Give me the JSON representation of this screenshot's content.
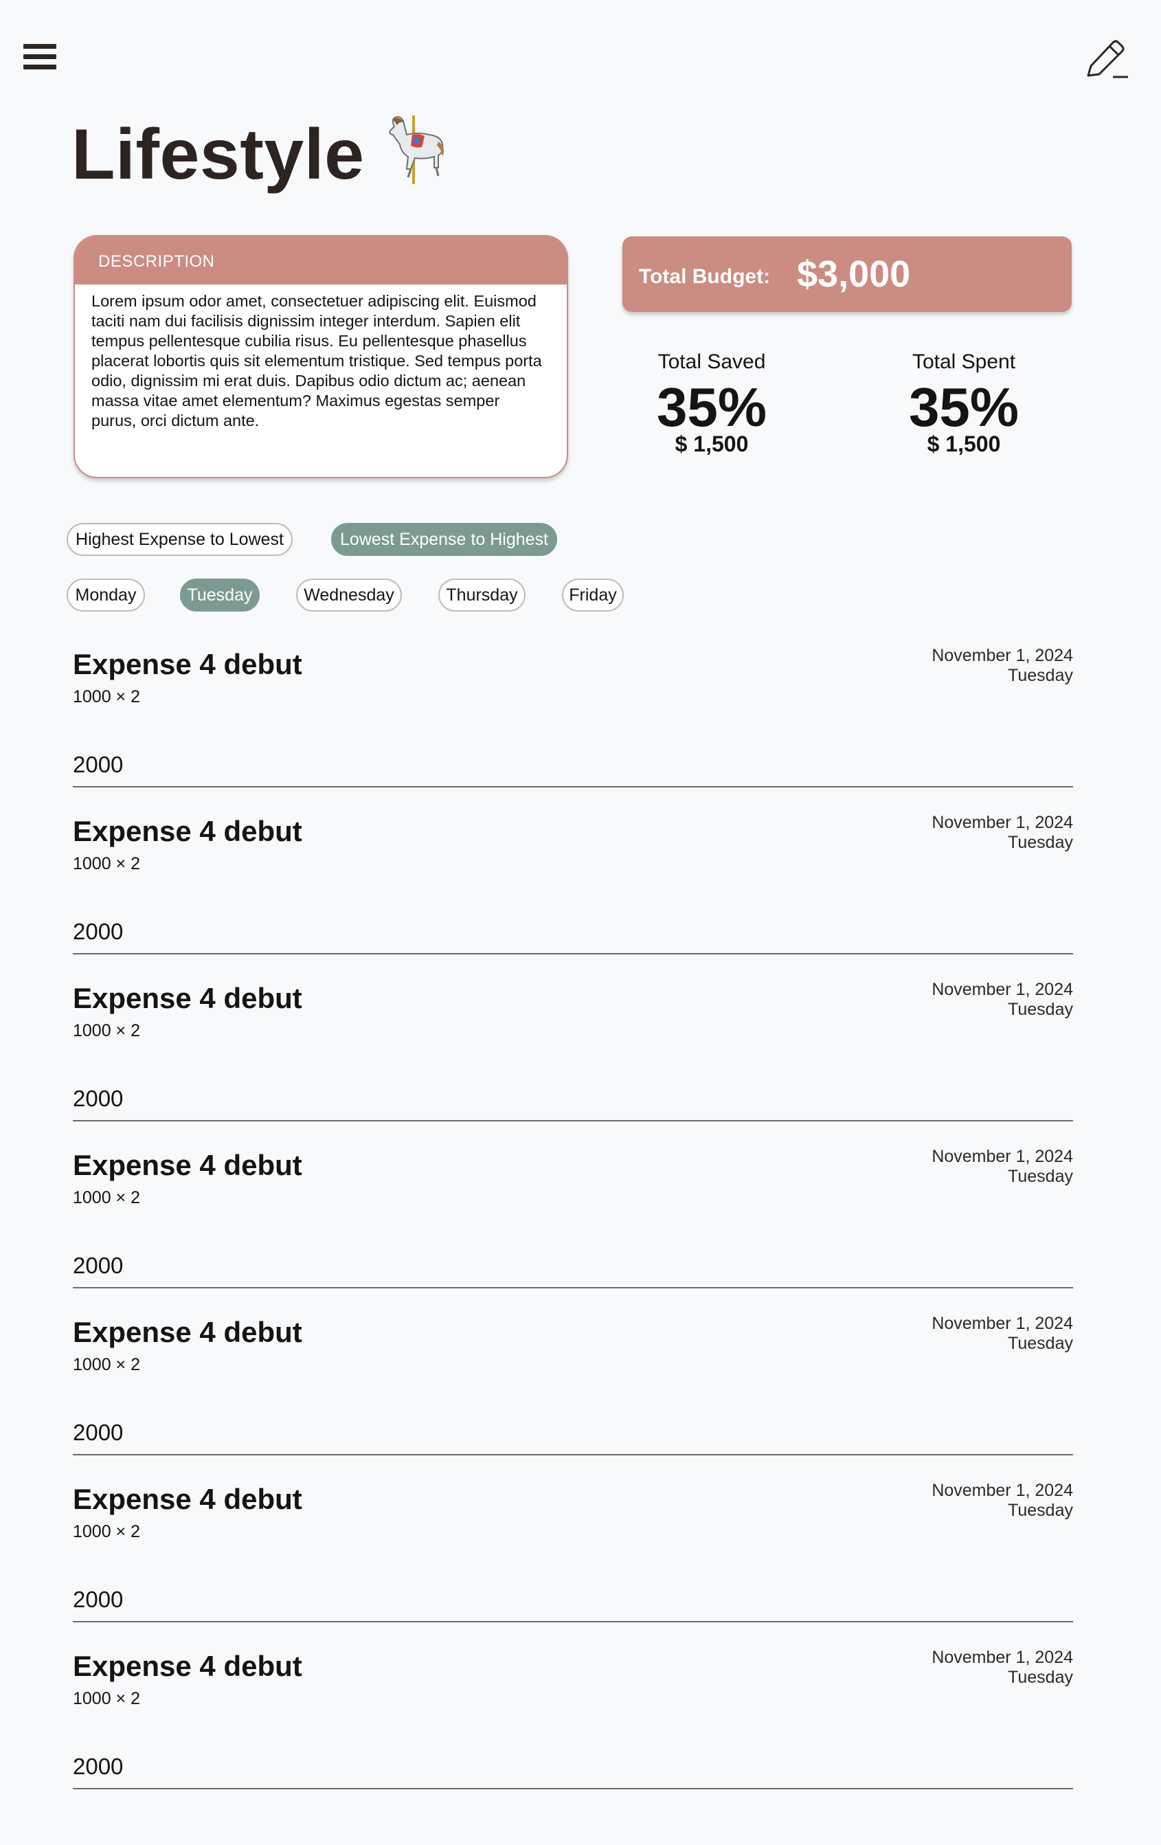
{
  "header": {
    "menu_icon": "hamburger-menu-icon",
    "edit_icon": "pencil-edit-icon",
    "title": "Lifestyle",
    "title_icon": "carousel-horse-icon"
  },
  "description": {
    "heading": "DESCRIPTION",
    "text": "Lorem ipsum odor amet, consectetuer adipiscing elit. Euismod taciti nam dui facilisis dignissim integer interdum. Sapien elit tempus pellentesque cubilia risus. Eu pellentesque phasellus placerat lobortis quis sit elementum tristique. Sed tempus porta odio, dignissim mi erat duis. Dapibus odio dictum ac; aenean massa vitae amet elementum? Maximus egestas semper purus, orci dictum ante."
  },
  "budget": {
    "label": "Total Budget:",
    "value": "$3,000"
  },
  "stats": {
    "saved": {
      "label": "Total Saved",
      "percent": "35%",
      "amount": "$ 1,500"
    },
    "spent": {
      "label": "Total Spent",
      "percent": "35%",
      "amount": "$ 1,500"
    }
  },
  "sort": {
    "options": [
      "Highest Expense to Lowest",
      "Lowest Expense to Highest"
    ],
    "selected": "Lowest Expense to Highest"
  },
  "days": {
    "options": [
      "Monday",
      "Tuesday",
      "Wednesday",
      "Thursday",
      "Friday"
    ],
    "selected": "Tuesday"
  },
  "colors": {
    "accent": "#cb8c82",
    "selected": "#7d9a92",
    "background": "#f7f9fb"
  },
  "expenses": [
    {
      "name": "Expense 4 debut",
      "calc": "1000 × 2",
      "date": "November 1, 2024",
      "day": "Tuesday",
      "total": "2000"
    },
    {
      "name": "Expense 4 debut",
      "calc": "1000 × 2",
      "date": "November 1, 2024",
      "day": "Tuesday",
      "total": "2000"
    },
    {
      "name": "Expense 4 debut",
      "calc": "1000 × 2",
      "date": "November 1, 2024",
      "day": "Tuesday",
      "total": "2000"
    },
    {
      "name": "Expense 4 debut",
      "calc": "1000 × 2",
      "date": "November 1, 2024",
      "day": "Tuesday",
      "total": "2000"
    },
    {
      "name": "Expense 4 debut",
      "calc": "1000 × 2",
      "date": "November 1, 2024",
      "day": "Tuesday",
      "total": "2000"
    },
    {
      "name": "Expense 4 debut",
      "calc": "1000 × 2",
      "date": "November 1, 2024",
      "day": "Tuesday",
      "total": "2000"
    },
    {
      "name": "Expense 4 debut",
      "calc": "1000 × 2",
      "date": "November 1, 2024",
      "day": "Tuesday",
      "total": "2000"
    }
  ]
}
